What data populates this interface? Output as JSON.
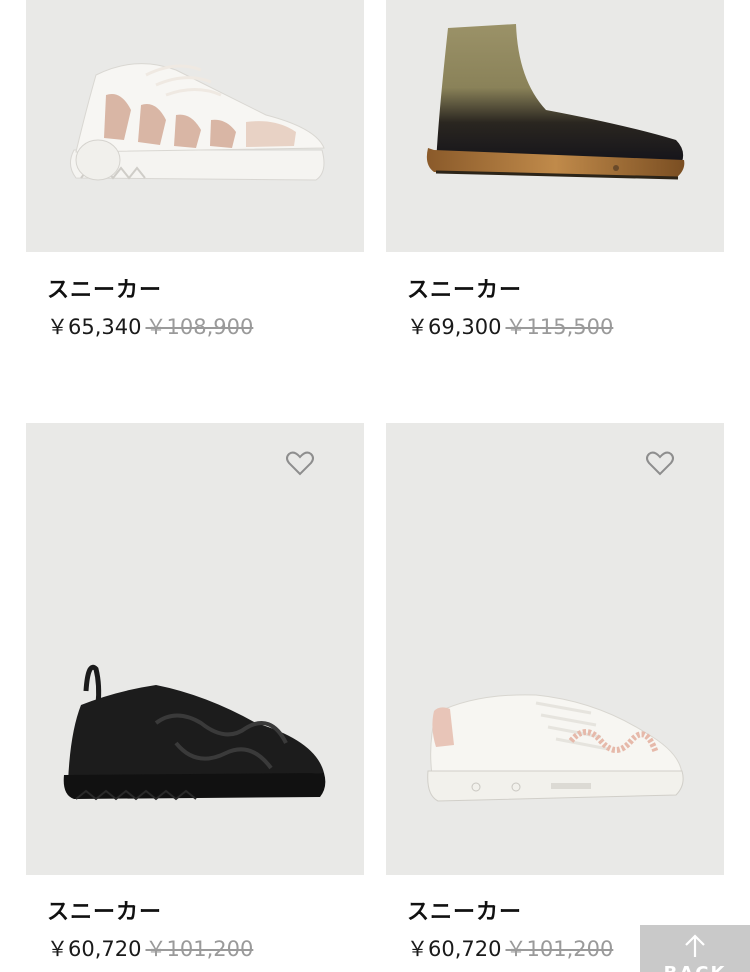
{
  "products": [
    {
      "name": "スニーカー",
      "price": "￥65,340",
      "original_price": "￥108,900",
      "favorite_icon": "heart-outline-icon",
      "favorite_visible": false
    },
    {
      "name": "スニーカー",
      "price": "￥69,300",
      "original_price": "￥115,500",
      "favorite_icon": "heart-outline-icon",
      "favorite_visible": false
    },
    {
      "name": "スニーカー",
      "price": "￥60,720",
      "original_price": "￥101,200",
      "favorite_icon": "heart-outline-icon",
      "favorite_visible": true
    },
    {
      "name": "スニーカー",
      "price": "￥60,720",
      "original_price": "￥101,200",
      "favorite_icon": "heart-outline-icon",
      "favorite_visible": true
    }
  ],
  "back_to_top": {
    "label": "BACK",
    "icon": "arrow-up-icon"
  },
  "colors": {
    "card_background": "#e9e9e7",
    "strikethrough_price": "#9a9a9a",
    "back_button": "#c9c9c9"
  }
}
